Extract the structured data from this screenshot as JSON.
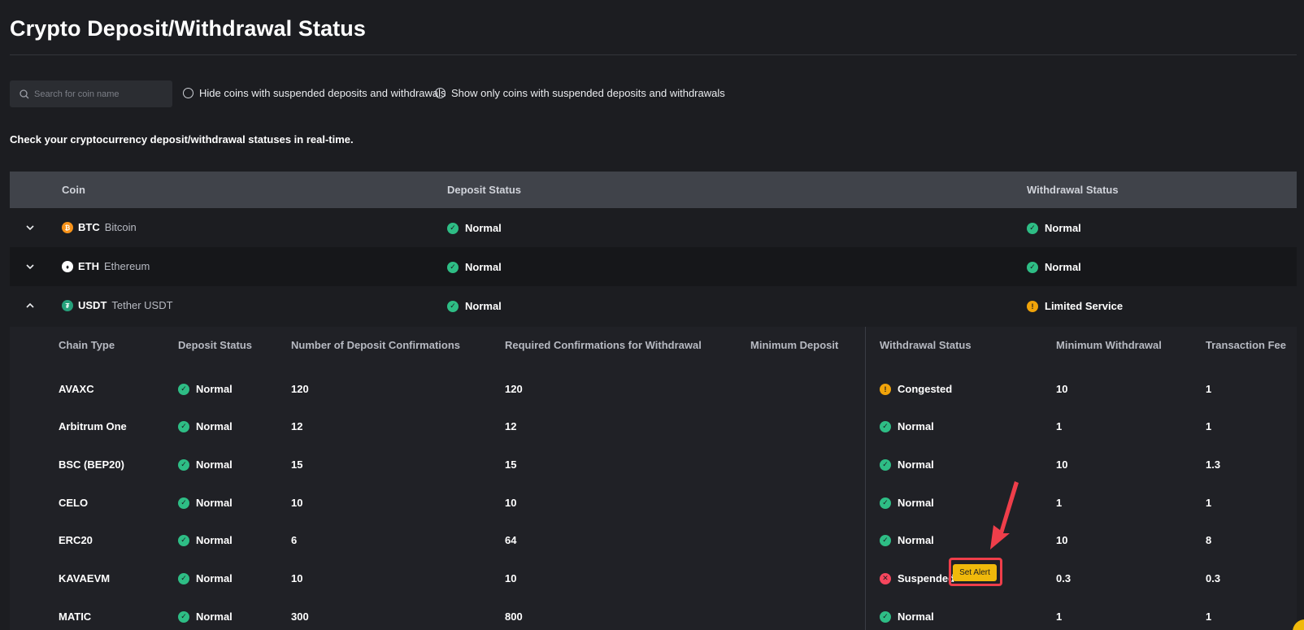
{
  "page": {
    "title": "Crypto Deposit/Withdrawal Status",
    "subtitle": "Check your cryptocurrency deposit/withdrawal statuses in real-time."
  },
  "filters": {
    "search_placeholder": "Search for coin name",
    "hide_suspended_label": "Hide coins with suspended deposits and withdrawals",
    "show_only_suspended_label": "Show only coins with suspended deposits and withdrawals"
  },
  "table": {
    "headers": {
      "coin": "Coin",
      "deposit": "Deposit Status",
      "withdrawal": "Withdrawal Status"
    },
    "coins": [
      {
        "symbol": "BTC",
        "name": "Bitcoin",
        "deposit": "Normal",
        "withdrawal": "Normal",
        "expanded": false,
        "icon": "btc-icon"
      },
      {
        "symbol": "ETH",
        "name": "Ethereum",
        "deposit": "Normal",
        "withdrawal": "Normal",
        "expanded": false,
        "icon": "eth-icon"
      },
      {
        "symbol": "USDT",
        "name": "Tether USDT",
        "deposit": "Normal",
        "withdrawal": "Limited Service",
        "expanded": true,
        "icon": "usdt-icon"
      }
    ]
  },
  "chains": {
    "headers": {
      "chain_type": "Chain Type",
      "deposit_status": "Deposit Status",
      "deposit_confirmations": "Number of Deposit Confirmations",
      "withdrawal_confirmations": "Required Confirmations for Withdrawal",
      "min_deposit": "Minimum Deposit",
      "withdrawal_status": "Withdrawal Status",
      "min_withdrawal": "Minimum Withdrawal",
      "fee": "Transaction Fee"
    },
    "rows": [
      {
        "chain": "AVAXC",
        "deposit": "Normal",
        "dep_conf": "120",
        "wd_conf": "120",
        "min_dep": "",
        "withdrawal": "Congested",
        "min_wd": "10",
        "fee": "1"
      },
      {
        "chain": "Arbitrum One",
        "deposit": "Normal",
        "dep_conf": "12",
        "wd_conf": "12",
        "min_dep": "",
        "withdrawal": "Normal",
        "min_wd": "1",
        "fee": "1"
      },
      {
        "chain": "BSC (BEP20)",
        "deposit": "Normal",
        "dep_conf": "15",
        "wd_conf": "15",
        "min_dep": "",
        "withdrawal": "Normal",
        "min_wd": "10",
        "fee": "1.3"
      },
      {
        "chain": "CELO",
        "deposit": "Normal",
        "dep_conf": "10",
        "wd_conf": "10",
        "min_dep": "",
        "withdrawal": "Normal",
        "min_wd": "1",
        "fee": "1"
      },
      {
        "chain": "ERC20",
        "deposit": "Normal",
        "dep_conf": "6",
        "wd_conf": "64",
        "min_dep": "",
        "withdrawal": "Normal",
        "min_wd": "10",
        "fee": "8"
      },
      {
        "chain": "KAVAEVM",
        "deposit": "Normal",
        "dep_conf": "10",
        "wd_conf": "10",
        "min_dep": "",
        "withdrawal": "Suspended",
        "min_wd": "0.3",
        "fee": "0.3"
      },
      {
        "chain": "MATIC",
        "deposit": "Normal",
        "dep_conf": "300",
        "wd_conf": "800",
        "min_dep": "",
        "withdrawal": "Normal",
        "min_wd": "1",
        "fee": "1"
      }
    ],
    "set_alert_label": "Set Alert"
  },
  "colors": {
    "background": "#1c1d21",
    "header_bg": "#40434a",
    "normal": "#2ebd85",
    "warning": "#f0a30a",
    "suspended": "#f6465d",
    "accent": "#f0b90b",
    "annotation": "#ef3e4a"
  }
}
